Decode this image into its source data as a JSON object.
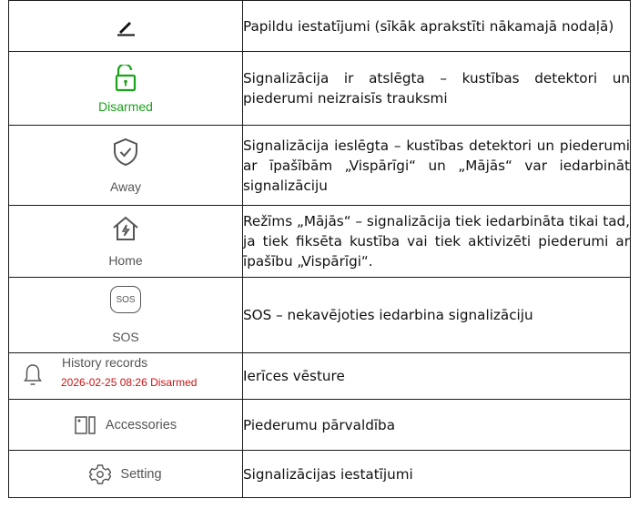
{
  "rows": [
    {
      "icon": "pencil-icon",
      "label": "",
      "desc": "Papildu iestatījumi (sīkāk aprakstīti nākamajā nodaļā)"
    },
    {
      "icon": "unlocked-padlock-icon",
      "label": "Disarmed",
      "label_color": "#1aa31a",
      "desc": "Signalizācija ir atslēgta – kustības detektori un piederumi neizraisīs trauksmi"
    },
    {
      "icon": "shield-check-icon",
      "label": "Away",
      "desc": "Signalizācija ieslēgta – kustības detektori un piederumi ar īpašībām „Vispārīgi“ un „Mājās“ var iedarbināt signalizāciju"
    },
    {
      "icon": "home-bolt-icon",
      "label": "Home",
      "desc": "Režīms „Mājās“ – signalizācija tiek iedarbināta tikai tad, ja tiek fiksēta kustība vai tiek aktivizēti piederumi ar īpašību „Vispārīgi“."
    },
    {
      "icon": "sos-icon",
      "icon_text": "SOS",
      "label": "SOS",
      "desc": "SOS – nekavējoties iedarbina signalizāciju"
    },
    {
      "icon": "bell-icon",
      "label": "History records",
      "sub": "2026-02-25 08:26 Disarmed",
      "sub_color": "#cc1111",
      "desc": "Ierīces vēsture"
    },
    {
      "icon": "door-sensor-icon",
      "label": "Accessories",
      "desc": "Piederumu pārvaldība"
    },
    {
      "icon": "gear-icon",
      "label": "Setting",
      "desc": "Signalizācijas iestatījumi"
    }
  ]
}
